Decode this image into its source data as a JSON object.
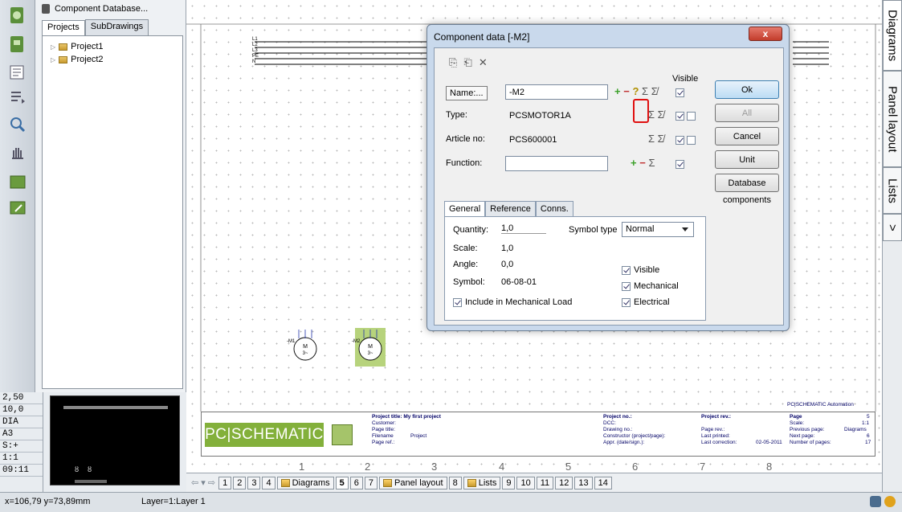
{
  "panel": {
    "title": "Component Database...",
    "tabs": [
      "Projects",
      "SubDrawings"
    ],
    "tree": [
      "Project1",
      "Project2"
    ]
  },
  "status_col": [
    "2,50",
    "10,0",
    "DIA",
    "A3",
    "S:+",
    "1:1",
    "09:11"
  ],
  "right_tabs": [
    "Diagrams",
    "Panel layout",
    "Lists",
    ">"
  ],
  "column_numbers": [
    "1",
    "2",
    "3",
    "4",
    "5",
    "6",
    "7",
    "8"
  ],
  "title_block": {
    "brand_top": "PC|SCHEMATIC Automation",
    "logo": "PC|SCHEMATIC",
    "project_title": "Project title: My first project",
    "customer": "Customer:",
    "page_title": "Page title:",
    "filename_label": "Filename",
    "filename_value": "Project",
    "page_ref": "Page ref.:",
    "project_no": "Project no.:",
    "dcc": "DCC:",
    "drawing_no": "Drawing no.:",
    "constructor": "Constructor (project/page):",
    "appr": "Appr. (date/sign.):",
    "project_rev": "Project rev.:",
    "page_rev": "Page rev.:",
    "last_printed": "Last printed:",
    "last_correction": "Last correction:",
    "last_correction_date": "02-05-2011",
    "page": "Page",
    "page_val": "5",
    "scale": "Scale:",
    "scale_val": "1:1",
    "prev_page": "Previous page:",
    "prev_page_val": "Diagrams",
    "next_page": "Next page:",
    "next_page_val": "6",
    "num_pages": "Number of pages:",
    "num_pages_val": "17"
  },
  "page_tabs": {
    "pages": [
      "1",
      "2",
      "3",
      "4"
    ],
    "diagrams": "Diagrams",
    "cur": "5",
    "mid": [
      "6",
      "7"
    ],
    "panel_layout": "Panel layout",
    "p8": "8",
    "lists": "Lists",
    "tail": [
      "9",
      "10",
      "11",
      "12",
      "13",
      "14"
    ]
  },
  "statusbar": {
    "coords": "x=106,79 y=73,89mm",
    "layer": "Layer=1:Layer 1"
  },
  "dialog": {
    "title": "Component data [-M2]",
    "close": "x",
    "buttons": {
      "ok": "Ok",
      "all": "All",
      "cancel": "Cancel",
      "unit": "Unit",
      "database": "Database"
    },
    "components_label": "components",
    "visible_header": "Visible",
    "fields": {
      "name_label": "Name:...",
      "name_value": "-M2",
      "type_label": "Type:",
      "type_value": "PCSMOTOR1A",
      "article_label": "Article no:",
      "article_value": "PCS600001",
      "function_label": "Function:",
      "function_value": ""
    },
    "tabs": [
      "General",
      "Reference",
      "Conns."
    ],
    "general": {
      "quantity_label": "Quantity:",
      "quantity_value": "1,0",
      "scale_label": "Scale:",
      "scale_value": "1,0",
      "angle_label": "Angle:",
      "angle_value": "0,0",
      "symbol_label": "Symbol:",
      "symbol_value": "06-08-01",
      "symbol_type_label": "Symbol type",
      "symbol_type_value": "Normal",
      "include_mech": "Include in Mechanical Load",
      "visible": "Visible",
      "mechanical": "Mechanical",
      "electrical": "Electrical"
    }
  },
  "motor_labels": [
    "-M1",
    "-M2"
  ],
  "bus_labels": [
    "L1",
    "L2",
    "L3",
    "PE",
    "N"
  ]
}
